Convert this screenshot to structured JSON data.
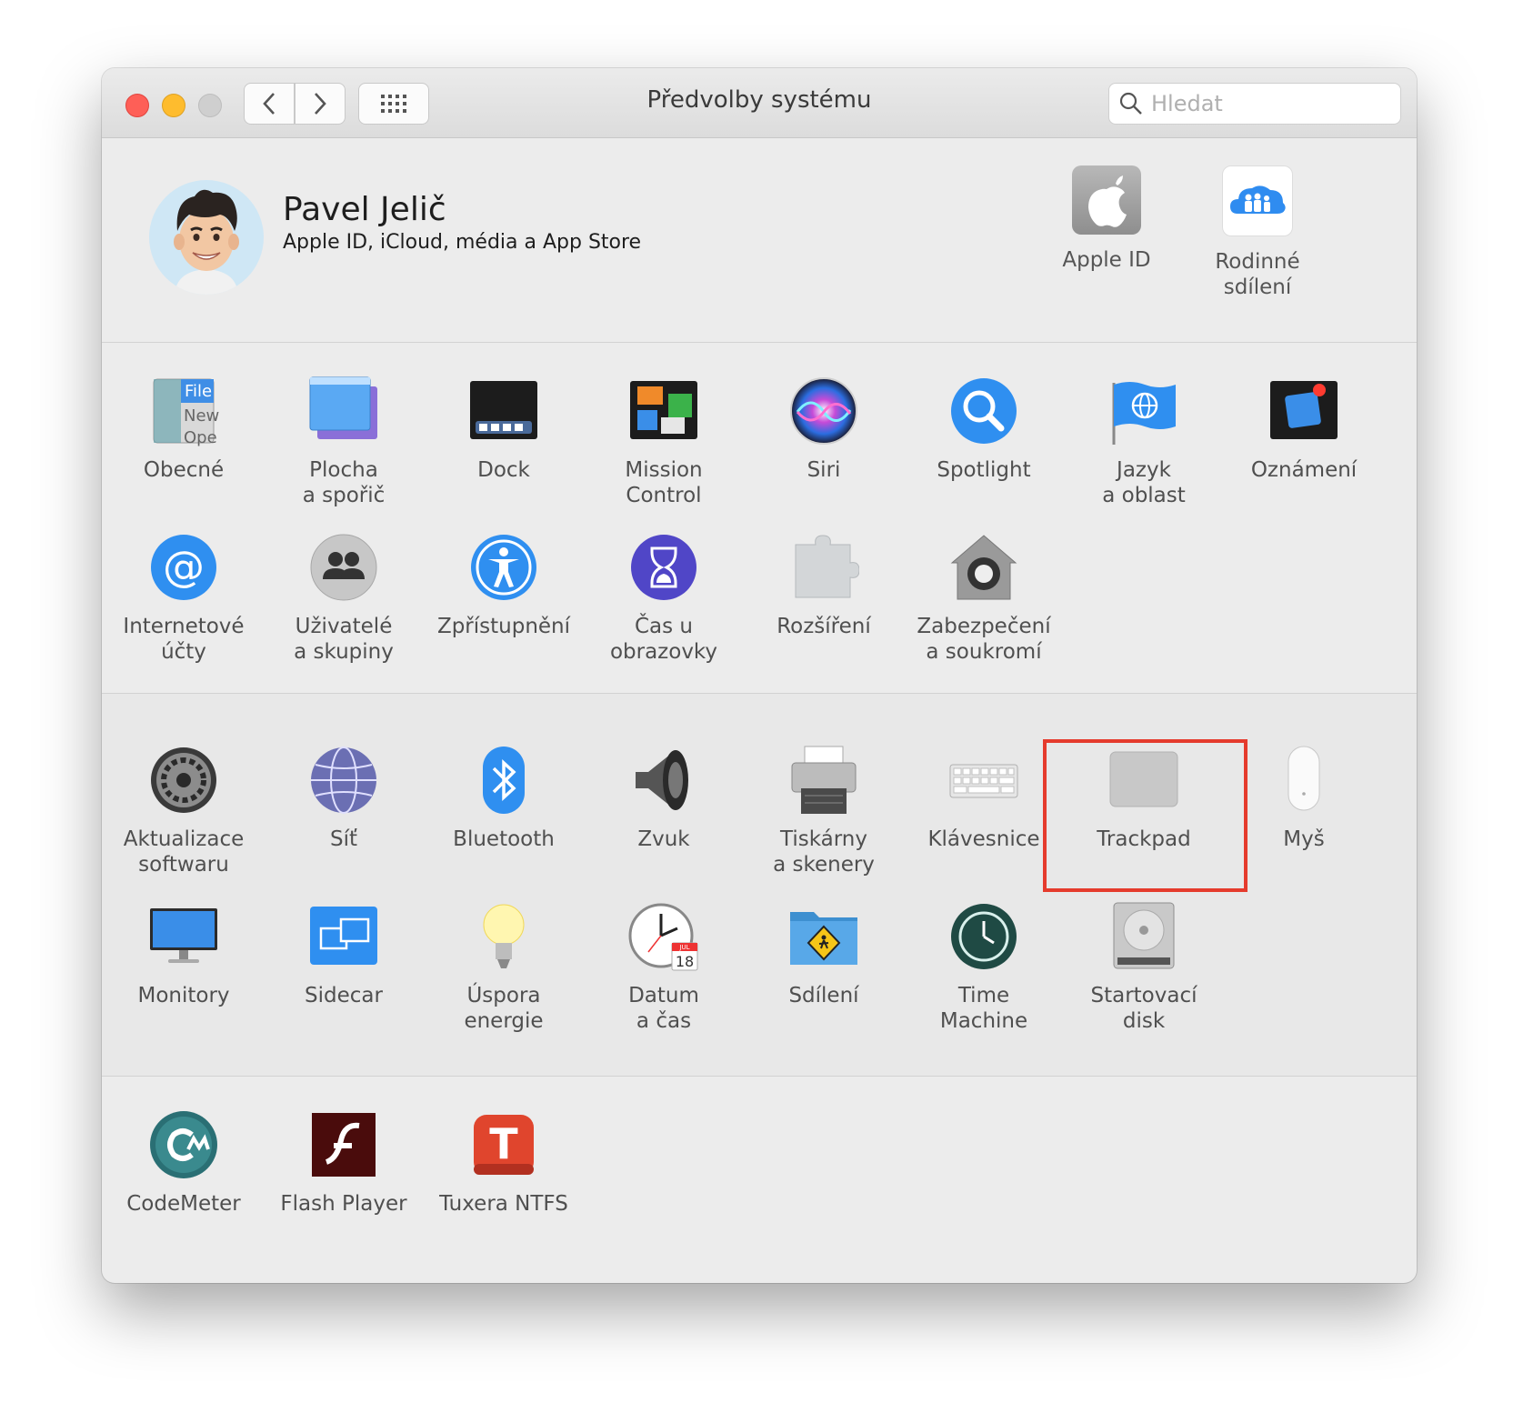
{
  "window": {
    "title": "Předvolby systému",
    "search_placeholder": "Hledat"
  },
  "profile": {
    "name": "Pavel Jelič",
    "subtitle": "Apple ID, iCloud, média a App Store",
    "items": [
      {
        "label": "Apple ID",
        "icon": "apple-id-icon"
      },
      {
        "label": "Rodinné\nsdílení",
        "icon": "family-sharing-icon"
      }
    ]
  },
  "sections": [
    {
      "panes": [
        {
          "label": "Obecné",
          "icon": "general-icon"
        },
        {
          "label": "Plocha\na spořič",
          "icon": "desktop-screensaver-icon"
        },
        {
          "label": "Dock",
          "icon": "dock-icon"
        },
        {
          "label": "Mission\nControl",
          "icon": "mission-control-icon"
        },
        {
          "label": "Siri",
          "icon": "siri-icon"
        },
        {
          "label": "Spotlight",
          "icon": "spotlight-icon"
        },
        {
          "label": "Jazyk\na oblast",
          "icon": "language-region-icon"
        },
        {
          "label": "Oznámení",
          "icon": "notifications-icon"
        },
        {
          "label": "Internetové\núčty",
          "icon": "internet-accounts-icon"
        },
        {
          "label": "Uživatelé\na skupiny",
          "icon": "users-groups-icon"
        },
        {
          "label": "Zpřístupnění",
          "icon": "accessibility-icon"
        },
        {
          "label": "Čas u obrazovky",
          "icon": "screen-time-icon"
        },
        {
          "label": "Rozšíření",
          "icon": "extensions-icon"
        },
        {
          "label": "Zabezpečení\na soukromí",
          "icon": "security-privacy-icon"
        }
      ]
    },
    {
      "panes": [
        {
          "label": "Aktualizace\nsoftwaru",
          "icon": "software-update-icon"
        },
        {
          "label": "Síť",
          "icon": "network-icon"
        },
        {
          "label": "Bluetooth",
          "icon": "bluetooth-icon"
        },
        {
          "label": "Zvuk",
          "icon": "sound-icon"
        },
        {
          "label": "Tiskárny\na skenery",
          "icon": "printers-scanners-icon"
        },
        {
          "label": "Klávesnice",
          "icon": "keyboard-icon"
        },
        {
          "label": "Trackpad",
          "icon": "trackpad-icon"
        },
        {
          "label": "Myš",
          "icon": "mouse-icon"
        },
        {
          "label": "Monitory",
          "icon": "displays-icon"
        },
        {
          "label": "Sidecar",
          "icon": "sidecar-icon"
        },
        {
          "label": "Úspora\nenergie",
          "icon": "energy-saver-icon"
        },
        {
          "label": "Datum\na čas",
          "icon": "date-time-icon"
        },
        {
          "label": "Sdílení",
          "icon": "sharing-icon"
        },
        {
          "label": "Time\nMachine",
          "icon": "time-machine-icon"
        },
        {
          "label": "Startovací\ndisk",
          "icon": "startup-disk-icon"
        }
      ]
    },
    {
      "panes": [
        {
          "label": "CodeMeter",
          "icon": "codemeter-icon"
        },
        {
          "label": "Flash Player",
          "icon": "flash-player-icon"
        },
        {
          "label": "Tuxera NTFS",
          "icon": "tuxera-ntfs-icon"
        }
      ]
    }
  ],
  "icon_text": {
    "file": "File",
    "new": "New",
    "open": "Ope",
    "month": "JUL",
    "day": "18",
    "at": "@",
    "tuxera": "T"
  },
  "colors": {
    "highlight": "#e53b2d",
    "close": "#fe5f57",
    "minimize": "#febc2e",
    "zoom": "#cfcfcf"
  }
}
